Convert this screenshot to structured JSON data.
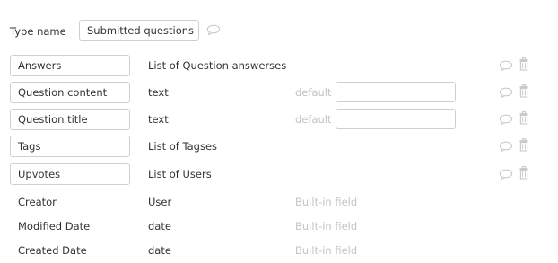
{
  "type": {
    "label": "Type name",
    "value": "Submitted questions"
  },
  "fields": [
    {
      "name": "Answers",
      "type": "List of Question answerses",
      "editable": true,
      "has_default": false
    },
    {
      "name": "Question content",
      "type": "text",
      "editable": true,
      "has_default": true,
      "default_label": "default",
      "default_value": ""
    },
    {
      "name": "Question title",
      "type": "text",
      "editable": true,
      "has_default": true,
      "default_label": "default",
      "default_value": ""
    },
    {
      "name": "Tags",
      "type": "List of Tagses",
      "editable": true,
      "has_default": false
    },
    {
      "name": "Upvotes",
      "type": "List of Users",
      "editable": true,
      "has_default": false
    }
  ],
  "builtin_fields": [
    {
      "name": "Creator",
      "type": "User",
      "note": "Built-in field"
    },
    {
      "name": "Modified Date",
      "type": "date",
      "note": "Built-in field"
    },
    {
      "name": "Created Date",
      "type": "date",
      "note": "Built-in field"
    }
  ],
  "icons": {
    "comment": "comment-icon",
    "delete": "trash-icon"
  },
  "colors": {
    "text": "#333333",
    "muted": "#c4c4c4",
    "border": "#cfcfcf",
    "icon": "#c8c8c8"
  }
}
